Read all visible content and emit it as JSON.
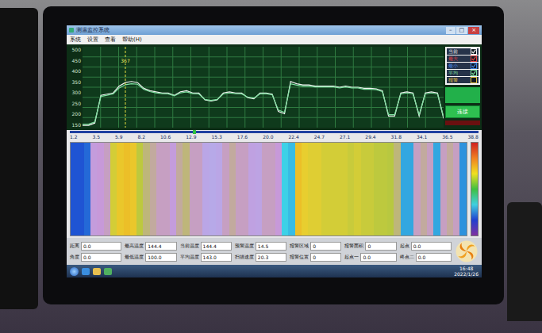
{
  "window": {
    "title": "测温监控系统",
    "controls": [
      "–",
      "□",
      "×"
    ]
  },
  "menu": [
    {
      "label": "系统"
    },
    {
      "label": "设置"
    },
    {
      "label": "查看"
    },
    {
      "label": "帮助(H)"
    }
  ],
  "chart": {
    "y_ticks": [
      "500",
      "450",
      "400",
      "350",
      "300",
      "250",
      "200",
      "150"
    ],
    "y_min": 150,
    "y_max": 500,
    "series": [
      {
        "name": "current",
        "color": "#f2f2f2",
        "values": [
          160,
          160,
          170,
          290,
          295,
          300,
          330,
          345,
          350,
          345,
          320,
          310,
          305,
          300,
          300,
          290,
          305,
          310,
          300,
          300,
          270,
          265,
          270,
          300,
          305,
          300,
          300,
          280,
          275,
          300,
          300,
          295,
          220,
          210,
          350,
          340,
          335,
          335,
          330,
          330,
          330,
          330,
          325,
          330,
          325,
          325,
          320,
          320,
          318,
          310,
          200,
          200,
          300,
          305,
          300,
          200,
          300,
          305,
          300,
          190
        ]
      },
      {
        "name": "average",
        "color": "#7fe0a0",
        "values": [
          165,
          165,
          175,
          285,
          290,
          296,
          322,
          336,
          340,
          338,
          316,
          306,
          301,
          297,
          296,
          288,
          300,
          305,
          297,
          296,
          272,
          268,
          272,
          296,
          300,
          297,
          296,
          282,
          278,
          296,
          297,
          292,
          226,
          216,
          340,
          334,
          330,
          330,
          326,
          326,
          326,
          326,
          322,
          326,
          322,
          322,
          316,
          316,
          314,
          306,
          206,
          206,
          296,
          300,
          296,
          206,
          296,
          300,
          296,
          196
        ]
      }
    ],
    "cursor": {
      "index": 7,
      "label": "367"
    }
  },
  "legend": [
    {
      "label": "当前",
      "checked": true,
      "color": "#f2f2f2"
    },
    {
      "label": "最大",
      "checked": true,
      "color": "#e04040"
    },
    {
      "label": "最小",
      "checked": true,
      "color": "#4080e0"
    },
    {
      "label": "平均",
      "checked": true,
      "color": "#7fe0a0"
    },
    {
      "label": "报警",
      "checked": false,
      "color": "#e0c040"
    }
  ],
  "buttons": [
    {
      "label": "连接"
    }
  ],
  "ruler": {
    "labels": [
      "1.2",
      "3.5",
      "5.9",
      "8.2",
      "10.6",
      "12.9",
      "15.3",
      "17.6",
      "20.0",
      "22.4",
      "24.7",
      "27.1",
      "29.4",
      "31.8",
      "34.1",
      "36.5",
      "38.8"
    ]
  },
  "fields": [
    {
      "label": "距离",
      "value": "0.0"
    },
    {
      "label": "最高温度",
      "value": "144.4"
    },
    {
      "label": "当前温度",
      "value": "144.4"
    },
    {
      "label": "预警温度",
      "value": "14.5"
    },
    {
      "label": "报警区域",
      "value": "0"
    },
    {
      "label": "报警面积",
      "value": "0"
    },
    {
      "label": "起点",
      "value": "0.0"
    },
    {
      "label": "角度",
      "value": "0.0"
    },
    {
      "label": "最低温度",
      "value": "100.0"
    },
    {
      "label": "平均温度",
      "value": "143.0"
    },
    {
      "label": "扫描速度",
      "value": "20.3"
    },
    {
      "label": "报警位置",
      "value": "0"
    },
    {
      "label": "起点一",
      "value": "0.0"
    },
    {
      "label": "终点二",
      "value": "0.0"
    }
  ],
  "taskbar": {
    "time": "16:48",
    "date": "2022/1/26"
  }
}
